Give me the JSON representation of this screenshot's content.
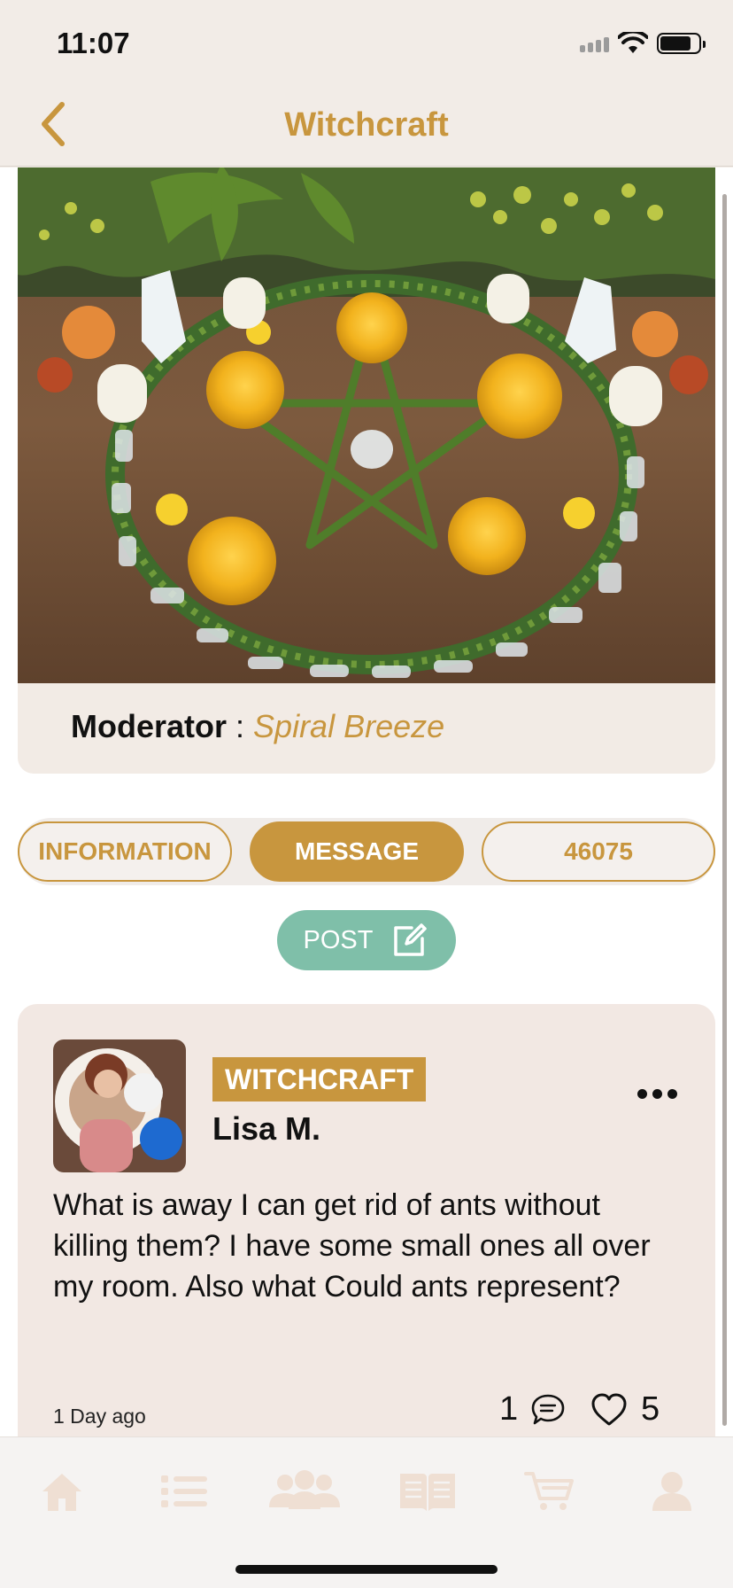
{
  "status_bar": {
    "time": "11:07"
  },
  "nav": {
    "title": "Witchcraft",
    "back_icon": "chevron-left-icon"
  },
  "hero": {
    "moderator_label": "Moderator",
    "moderator_separator": " : ",
    "moderator_name": "Spiral Breeze"
  },
  "tabs": [
    {
      "label": "INFORMATION",
      "active": false
    },
    {
      "label": "MESSAGE",
      "active": true
    },
    {
      "label": "46075",
      "active": false
    }
  ],
  "post_button": {
    "label": "POST",
    "icon": "edit-icon"
  },
  "post": {
    "category": "WITCHCRAFT",
    "author": "Lisa M.",
    "body": "What is away I can get rid of ants without killing them? I have some small ones all over my room. Also what Could ants represent?",
    "time": "1 Day ago",
    "comment_count": "1",
    "like_count": "5"
  },
  "tab_bar": [
    {
      "icon": "home-icon"
    },
    {
      "icon": "list-icon"
    },
    {
      "icon": "community-icon"
    },
    {
      "icon": "book-icon"
    },
    {
      "icon": "cart-icon"
    },
    {
      "icon": "profile-icon"
    }
  ],
  "colors": {
    "accent": "#c8963e",
    "post_button": "#7fbfa9",
    "background": "#f2ece7",
    "tab_icon_inactive": "#efdfd3"
  }
}
